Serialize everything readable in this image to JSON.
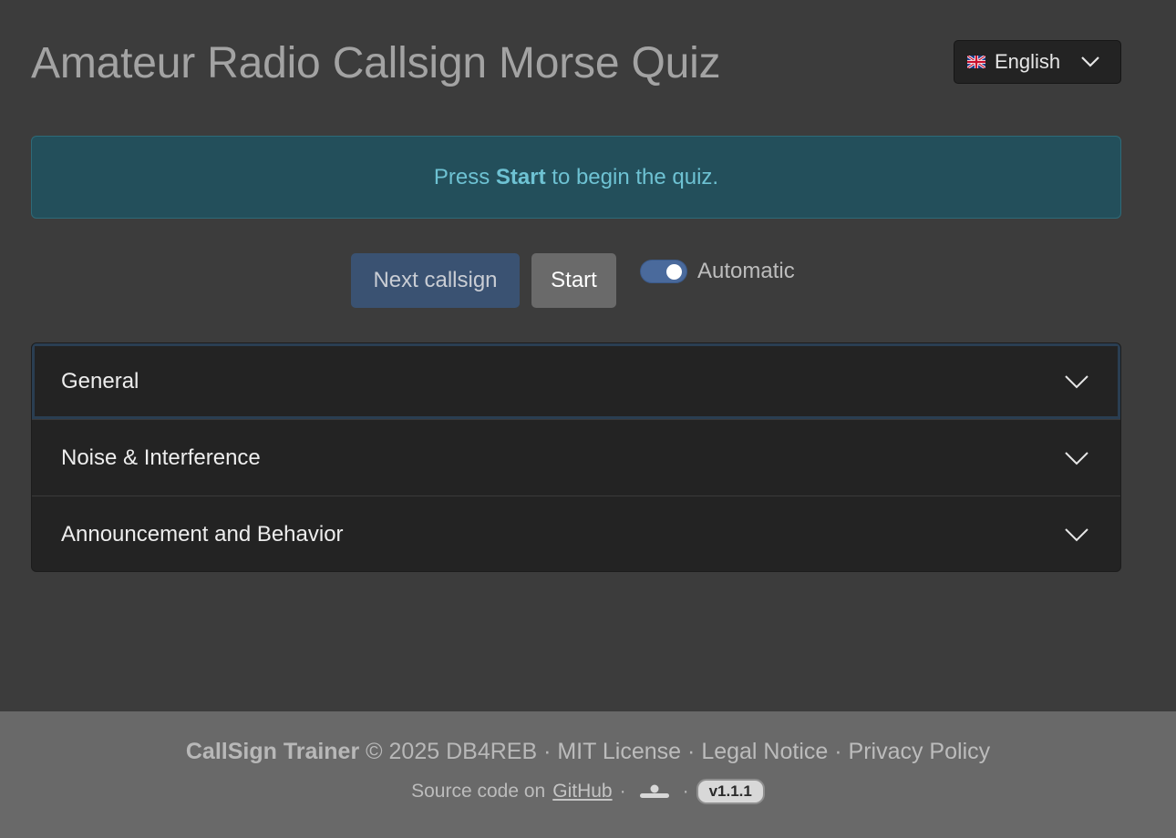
{
  "header": {
    "title": "Amateur Radio Callsign Morse Quiz",
    "language": {
      "selected": "English",
      "flag_icon": "uk-flag-icon"
    }
  },
  "alert": {
    "prefix": "Press ",
    "bold": "Start",
    "suffix": " to begin the quiz."
  },
  "controls": {
    "next_label": "Next callsign",
    "start_label": "Start",
    "toggle_label": "Automatic",
    "toggle_on": true
  },
  "accordion": {
    "items": [
      {
        "label": "General"
      },
      {
        "label": "Noise & Interference"
      },
      {
        "label": "Announcement and Behavior"
      }
    ]
  },
  "footer": {
    "app_name": "CallSign Trainer",
    "copyright": "© 2025 DB4REB",
    "dot": "·",
    "mit": "MIT License",
    "legal": "Legal Notice",
    "privacy": "Privacy Policy",
    "source_prefix": "Source code on",
    "github": "GitHub",
    "version": "v1.1.1"
  },
  "colors": {
    "background": "#3c3c3c",
    "alert_bg": "#234f5b",
    "alert_text": "#6ec2d3",
    "next_button": "#3a5272",
    "start_button": "#6a6a6a",
    "accordion_bg": "#232323",
    "footer_bg": "#696969"
  }
}
